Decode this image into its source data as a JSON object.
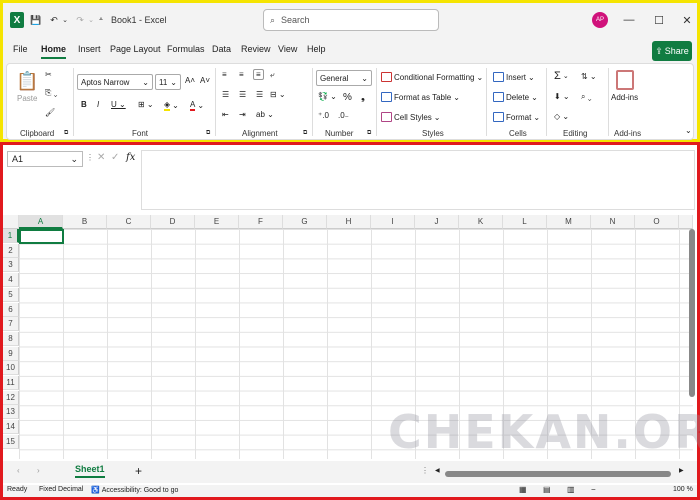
{
  "titlebar": {
    "app_icon": "excel-x-icon",
    "doc_title": "Book1 - Excel",
    "search_placeholder": "Search",
    "avatar": "AP"
  },
  "menu": {
    "items": [
      "File",
      "Home",
      "Insert",
      "Page Layout",
      "Formulas",
      "Data",
      "Review",
      "View",
      "Help"
    ],
    "active": "Home",
    "share_label": "Share"
  },
  "ribbon": {
    "clipboard": {
      "paste": "Paste",
      "label": "Clipboard"
    },
    "font": {
      "name": "Aptos Narrow",
      "size": "11",
      "label": "Font"
    },
    "alignment": {
      "label": "Alignment"
    },
    "number": {
      "format": "General",
      "label": "Number"
    },
    "styles": {
      "conditional": "Conditional Formatting",
      "table": "Format as Table",
      "cell": "Cell Styles",
      "label": "Styles"
    },
    "cells": {
      "insert": "Insert",
      "delete": "Delete",
      "format": "Format",
      "label": "Cells"
    },
    "editing": {
      "label": "Editing"
    },
    "addins": {
      "button": "Add-ins",
      "label": "Add-ins"
    }
  },
  "formula_bar": {
    "name_box": "A1",
    "fx": "fx"
  },
  "grid": {
    "columns": [
      "A",
      "B",
      "C",
      "D",
      "E",
      "F",
      "G",
      "H",
      "I",
      "J",
      "K",
      "L",
      "M",
      "N",
      "O"
    ],
    "rows": [
      "1",
      "2",
      "3",
      "4",
      "5",
      "6",
      "7",
      "8",
      "9",
      "10",
      "11",
      "12",
      "13",
      "14",
      "15"
    ],
    "selected": "A1"
  },
  "sheets": {
    "tabs": [
      "Sheet1"
    ],
    "add": "+"
  },
  "status": {
    "ready": "Ready",
    "fixed_decimal": "Fixed Decimal",
    "accessibility": "Accessibility: Good to go",
    "zoom": "100 %"
  },
  "watermark": "CHEKAN.ORG",
  "colors": {
    "accent": "#107c41",
    "top_frame": "#f5e400",
    "bottom_frame": "#e1191e"
  }
}
